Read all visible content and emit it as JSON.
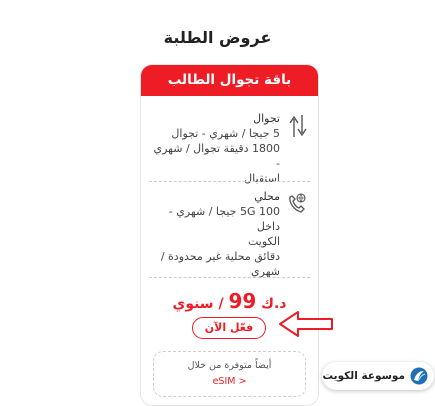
{
  "page_title": "عروض الطلبة",
  "card": {
    "header": "باقة تجوال الطالب",
    "features": [
      {
        "icon": "roaming-arrows-icon",
        "title": "تجوال",
        "lines": [
          "5 جيجا / شهري - تجوال",
          "1800 دقيقة تجوال / شهري -",
          "استقبال"
        ]
      },
      {
        "icon": "local-phone-icon",
        "title": "محلي",
        "lines": [
          "100 5G جيجا / شهري - داخل",
          "الكويت",
          "دقائق محلية غير محدودة /",
          "شهري"
        ]
      }
    ],
    "price": {
      "currency": "د.ك",
      "amount": "99",
      "period": "/ سنوي"
    },
    "activate_label": "فعّل الآن",
    "also_available": "أيضاً متوفرة من خلال",
    "esim_link": "< eSIM"
  },
  "watermark": {
    "text": "موسوعة الكويت",
    "icon": "site-logo-icon"
  },
  "colors": {
    "accent": "#ee1c25"
  }
}
